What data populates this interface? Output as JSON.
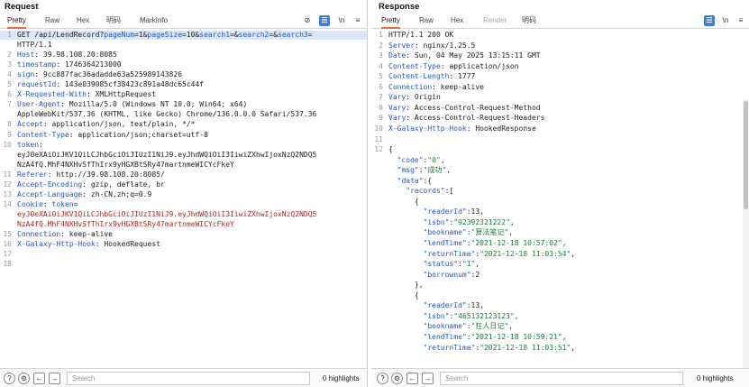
{
  "request": {
    "title": "Request",
    "tabs": [
      "Pretty",
      "Raw",
      "Hex",
      "明码",
      "MarkInfo"
    ],
    "active_tab": "Pretty",
    "tools": {
      "visibility_off": "⊘",
      "list": "☰",
      "ln": "\\n",
      "menu": "≡"
    },
    "lines": [
      {
        "n": "1",
        "segs": [
          {
            "t": "GET /api/LendRecord?",
            "c": "k-method"
          },
          {
            "t": "pageNum",
            "c": "k-param"
          },
          {
            "t": "=1&",
            "c": "k-val"
          },
          {
            "t": "pageSize",
            "c": "k-param"
          },
          {
            "t": "=10&",
            "c": "k-val"
          },
          {
            "t": "search1",
            "c": "k-param"
          },
          {
            "t": "=&",
            "c": "k-val"
          },
          {
            "t": "search2",
            "c": "k-param"
          },
          {
            "t": "=&",
            "c": "k-val"
          },
          {
            "t": "search3",
            "c": "k-param"
          },
          {
            "t": "=",
            "c": "k-val"
          }
        ]
      },
      {
        "n": "",
        "segs": [
          {
            "t": "HTTP/1.1",
            "c": "k-val"
          }
        ]
      },
      {
        "n": "2",
        "segs": [
          {
            "t": "Host",
            "c": "k-header"
          },
          {
            "t": ": 39.98.108.20:8085",
            "c": "k-val"
          }
        ]
      },
      {
        "n": "3",
        "segs": [
          {
            "t": "timestamp",
            "c": "k-header"
          },
          {
            "t": ": 1746364213000",
            "c": "k-val"
          }
        ]
      },
      {
        "n": "4",
        "segs": [
          {
            "t": "sign",
            "c": "k-header"
          },
          {
            "t": ": 9cc887fac36adadde63a525989143826",
            "c": "k-val"
          }
        ]
      },
      {
        "n": "5",
        "segs": [
          {
            "t": "requestId",
            "c": "k-header"
          },
          {
            "t": ": 143e039085cf38423c891a48dc65c44f",
            "c": "k-val"
          }
        ]
      },
      {
        "n": "6",
        "segs": [
          {
            "t": "X-Requested-With",
            "c": "k-header"
          },
          {
            "t": ": XMLHttpRequest",
            "c": "k-val"
          }
        ]
      },
      {
        "n": "7",
        "segs": [
          {
            "t": "User-Agent",
            "c": "k-header"
          },
          {
            "t": ": Mozilla/5.0 (Windows NT 10.0; Win64; x64)",
            "c": "k-val"
          }
        ]
      },
      {
        "n": "",
        "segs": [
          {
            "t": "AppleWebKit/537.36 (KHTML, like Gecko) Chrome/136.0.0.0 Safari/537.36",
            "c": "k-val"
          }
        ]
      },
      {
        "n": "8",
        "segs": [
          {
            "t": "Accept",
            "c": "k-header"
          },
          {
            "t": ": application/json, text/plain, */*",
            "c": "k-val"
          }
        ]
      },
      {
        "n": "9",
        "segs": [
          {
            "t": "Content-Type",
            "c": "k-header"
          },
          {
            "t": ": application/json;charset=utf-8",
            "c": "k-val"
          }
        ]
      },
      {
        "n": "10",
        "segs": [
          {
            "t": "token",
            "c": "k-header"
          },
          {
            "t": ":",
            "c": "k-val"
          }
        ]
      },
      {
        "n": "",
        "segs": [
          {
            "t": "eyJ0eXAiOiJKV1QiLCJhbGciOiJIUzI1NiJ9.eyJhdWQiOiI3IiwiZXhwIjoxNzQ2NDQ5",
            "c": "k-val"
          }
        ]
      },
      {
        "n": "",
        "segs": [
          {
            "t": "NzA4fQ.MhF4NXHvSfThIrx9yHGXBtSRy47martnmeWICYcFkeY",
            "c": "k-val"
          }
        ]
      },
      {
        "n": "11",
        "segs": [
          {
            "t": "Referer",
            "c": "k-header"
          },
          {
            "t": ": http://39.98.108.20:8085/",
            "c": "k-val"
          }
        ]
      },
      {
        "n": "12",
        "segs": [
          {
            "t": "Accept-Encoding",
            "c": "k-header"
          },
          {
            "t": ": gzip, deflate, br",
            "c": "k-val"
          }
        ]
      },
      {
        "n": "13",
        "segs": [
          {
            "t": "Accept-Language",
            "c": "k-header"
          },
          {
            "t": ": zh-CN,zh;q=0.9",
            "c": "k-val"
          }
        ]
      },
      {
        "n": "14",
        "segs": [
          {
            "t": "Cookie",
            "c": "k-header"
          },
          {
            "t": ": ",
            "c": "k-val"
          },
          {
            "t": "token",
            "c": "k-header"
          },
          {
            "t": "=",
            "c": "k-val"
          }
        ]
      },
      {
        "n": "",
        "segs": [
          {
            "t": "eyJ0eXAiOiJKV1QiLCJhbGciOiJIUzI1NiJ9.eyJhdWQiOiI3IiwiZXhwIjoxNzQ2NDQ5",
            "c": "k-red"
          }
        ]
      },
      {
        "n": "",
        "segs": [
          {
            "t": "NzA4fQ.MhF4NXHvSfThIrx9yHGXBtSRy47martnmeWICYcFkeY",
            "c": "k-red"
          }
        ]
      },
      {
        "n": "15",
        "segs": [
          {
            "t": "Connection",
            "c": "k-header"
          },
          {
            "t": ": keep-alive",
            "c": "k-val"
          }
        ]
      },
      {
        "n": "16",
        "segs": [
          {
            "t": "X-Galaxy-Http-Hook",
            "c": "k-header"
          },
          {
            "t": ": HookedRequest",
            "c": "k-val"
          }
        ]
      },
      {
        "n": "17",
        "segs": []
      },
      {
        "n": "18",
        "segs": []
      }
    ],
    "search_placeholder": "Search",
    "highlights": "0 highlights"
  },
  "response": {
    "title": "Response",
    "tabs": [
      "Pretty",
      "Raw",
      "Hex",
      "Render",
      "明码"
    ],
    "active_tab": "Pretty",
    "tools": {
      "list": "☰",
      "ln": "\\n",
      "menu": "≡"
    },
    "lines": [
      {
        "n": "1",
        "segs": [
          {
            "t": "HTTP/1.1 200 OK",
            "c": "k-val"
          }
        ]
      },
      {
        "n": "2",
        "segs": [
          {
            "t": "Server",
            "c": "k-header"
          },
          {
            "t": ": nginx/1.25.5",
            "c": "k-val"
          }
        ]
      },
      {
        "n": "3",
        "segs": [
          {
            "t": "Date",
            "c": "k-header"
          },
          {
            "t": ": Sun, 04 May 2025 13:15:11 GMT",
            "c": "k-val"
          }
        ]
      },
      {
        "n": "4",
        "segs": [
          {
            "t": "Content-Type",
            "c": "k-header"
          },
          {
            "t": ": application/json",
            "c": "k-val"
          }
        ]
      },
      {
        "n": "5",
        "segs": [
          {
            "t": "Content-Length",
            "c": "k-header"
          },
          {
            "t": ": 1777",
            "c": "k-val"
          }
        ]
      },
      {
        "n": "6",
        "segs": [
          {
            "t": "Connection",
            "c": "k-header"
          },
          {
            "t": ": keep-alive",
            "c": "k-val"
          }
        ]
      },
      {
        "n": "7",
        "segs": [
          {
            "t": "Vary",
            "c": "k-header"
          },
          {
            "t": ": Origin",
            "c": "k-val"
          }
        ]
      },
      {
        "n": "8",
        "segs": [
          {
            "t": "Vary",
            "c": "k-header"
          },
          {
            "t": ": Access-Control-Request-Method",
            "c": "k-val"
          }
        ]
      },
      {
        "n": "9",
        "segs": [
          {
            "t": "Vary",
            "c": "k-header"
          },
          {
            "t": ": Access-Control-Request-Headers",
            "c": "k-val"
          }
        ]
      },
      {
        "n": "10",
        "segs": [
          {
            "t": "X-Galaxy-Http-Hook",
            "c": "k-header"
          },
          {
            "t": ": HookedResponse",
            "c": "k-val"
          }
        ]
      },
      {
        "n": "11",
        "segs": []
      },
      {
        "n": "12",
        "segs": [
          {
            "t": "{",
            "c": "k-punct"
          }
        ]
      },
      {
        "n": "",
        "segs": [
          {
            "t": "  \"code\"",
            "c": "k-header"
          },
          {
            "t": ":",
            "c": "k-punct"
          },
          {
            "t": "\"0\"",
            "c": "k-str"
          },
          {
            "t": ",",
            "c": "k-punct"
          }
        ]
      },
      {
        "n": "",
        "segs": [
          {
            "t": "  \"msg\"",
            "c": "k-header"
          },
          {
            "t": ":",
            "c": "k-punct"
          },
          {
            "t": "\"成功\"",
            "c": "k-str"
          },
          {
            "t": ",",
            "c": "k-punct"
          }
        ]
      },
      {
        "n": "",
        "segs": [
          {
            "t": "  \"data\"",
            "c": "k-header"
          },
          {
            "t": ":{",
            "c": "k-punct"
          }
        ]
      },
      {
        "n": "",
        "segs": [
          {
            "t": "    \"records\"",
            "c": "k-header"
          },
          {
            "t": ":[",
            "c": "k-punct"
          }
        ]
      },
      {
        "n": "",
        "segs": [
          {
            "t": "      {",
            "c": "k-punct"
          }
        ]
      },
      {
        "n": "",
        "segs": [
          {
            "t": "        \"readerId\"",
            "c": "k-header"
          },
          {
            "t": ":13,",
            "c": "k-punct"
          }
        ]
      },
      {
        "n": "",
        "segs": [
          {
            "t": "        \"isbn\"",
            "c": "k-header"
          },
          {
            "t": ":",
            "c": "k-punct"
          },
          {
            "t": "\"92392321222\"",
            "c": "k-str"
          },
          {
            "t": ",",
            "c": "k-punct"
          }
        ]
      },
      {
        "n": "",
        "segs": [
          {
            "t": "        \"bookname\"",
            "c": "k-header"
          },
          {
            "t": ":",
            "c": "k-punct"
          },
          {
            "t": "\"算法笔记\"",
            "c": "k-str"
          },
          {
            "t": ",",
            "c": "k-punct"
          }
        ]
      },
      {
        "n": "",
        "segs": [
          {
            "t": "        \"lendTime\"",
            "c": "k-header"
          },
          {
            "t": ":",
            "c": "k-punct"
          },
          {
            "t": "\"2021-12-18 10:57:02\"",
            "c": "k-str"
          },
          {
            "t": ",",
            "c": "k-punct"
          }
        ]
      },
      {
        "n": "",
        "segs": [
          {
            "t": "        \"returnTime\"",
            "c": "k-header"
          },
          {
            "t": ":",
            "c": "k-punct"
          },
          {
            "t": "\"2021-12-18 11:03:54\"",
            "c": "k-str"
          },
          {
            "t": ",",
            "c": "k-punct"
          }
        ]
      },
      {
        "n": "",
        "segs": [
          {
            "t": "        \"status\"",
            "c": "k-header"
          },
          {
            "t": ":",
            "c": "k-punct"
          },
          {
            "t": "\"1\"",
            "c": "k-str"
          },
          {
            "t": ",",
            "c": "k-punct"
          }
        ]
      },
      {
        "n": "",
        "segs": [
          {
            "t": "        \"borrownum\"",
            "c": "k-header"
          },
          {
            "t": ":2",
            "c": "k-punct"
          }
        ]
      },
      {
        "n": "",
        "segs": [
          {
            "t": "      },",
            "c": "k-punct"
          }
        ]
      },
      {
        "n": "",
        "segs": [
          {
            "t": "      {",
            "c": "k-punct"
          }
        ]
      },
      {
        "n": "",
        "segs": [
          {
            "t": "        \"readerId\"",
            "c": "k-header"
          },
          {
            "t": ":13,",
            "c": "k-punct"
          }
        ]
      },
      {
        "n": "",
        "segs": [
          {
            "t": "        \"isbn\"",
            "c": "k-header"
          },
          {
            "t": ":",
            "c": "k-punct"
          },
          {
            "t": "\"465132123123\"",
            "c": "k-str"
          },
          {
            "t": ",",
            "c": "k-punct"
          }
        ]
      },
      {
        "n": "",
        "segs": [
          {
            "t": "        \"bookname\"",
            "c": "k-header"
          },
          {
            "t": ":",
            "c": "k-punct"
          },
          {
            "t": "\"狂人日记\"",
            "c": "k-str"
          },
          {
            "t": ",",
            "c": "k-punct"
          }
        ]
      },
      {
        "n": "",
        "segs": [
          {
            "t": "        \"lendTime\"",
            "c": "k-header"
          },
          {
            "t": ":",
            "c": "k-punct"
          },
          {
            "t": "\"2021-12-18 10:59:21\"",
            "c": "k-str"
          },
          {
            "t": ",",
            "c": "k-punct"
          }
        ]
      },
      {
        "n": "",
        "segs": [
          {
            "t": "        \"returnTime\"",
            "c": "k-header"
          },
          {
            "t": ":",
            "c": "k-punct"
          },
          {
            "t": "\"2021-12-18 11:03:51\"",
            "c": "k-str"
          },
          {
            "t": ",",
            "c": "k-punct"
          }
        ]
      }
    ],
    "search_placeholder": "Search",
    "highlights": "0 highlights"
  },
  "footer_icons": {
    "help": "?",
    "settings": "⚙",
    "prev": "←",
    "next": "→"
  },
  "colors": {
    "accent_tab": "#e8733a",
    "header_key": "#2457c5",
    "string_val": "#1a7f37",
    "cookie_val": "#b3261e",
    "button_blue": "#3f7dd6"
  }
}
